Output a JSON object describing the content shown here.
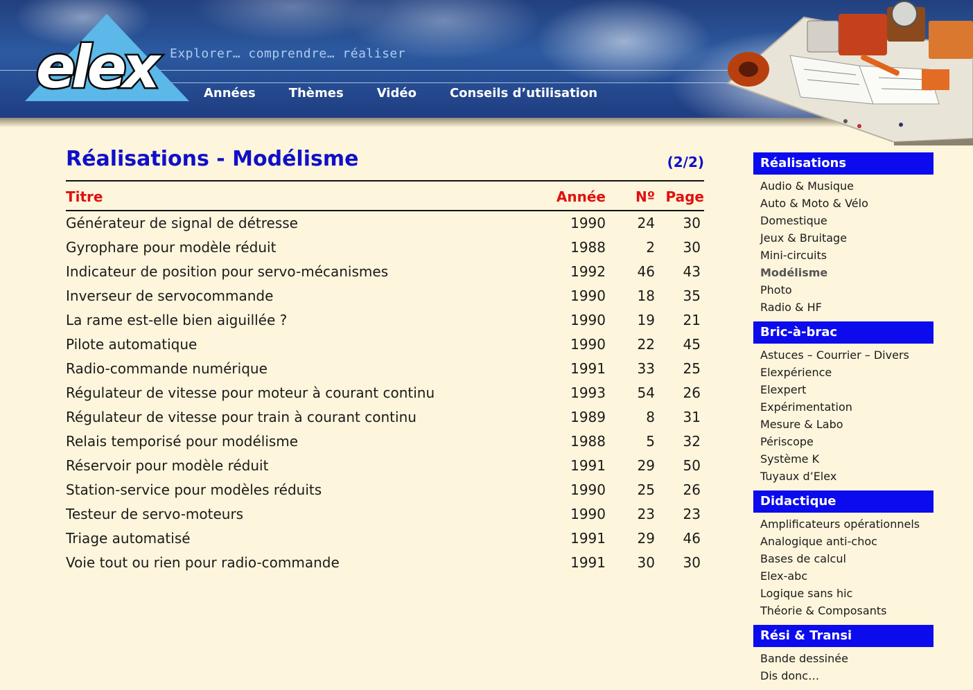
{
  "header": {
    "logo_text": "elex",
    "tagline": "Explorer… comprendre… réaliser",
    "nav": [
      "Années",
      "Thèmes",
      "Vidéo",
      "Conseils d’utilisation"
    ]
  },
  "main": {
    "title": "Réalisations - Modélisme",
    "page_indicator": "(2/2)",
    "columns": {
      "title": "Titre",
      "year": "Année",
      "number": "Nº",
      "page": "Page"
    },
    "rows": [
      {
        "title": "Générateur de signal de détresse",
        "year": "1990",
        "number": "24",
        "page": "30"
      },
      {
        "title": "Gyrophare pour modèle réduit",
        "year": "1988",
        "number": "2",
        "page": "30"
      },
      {
        "title": "Indicateur de position pour servo-mécanismes",
        "year": "1992",
        "number": "46",
        "page": "43"
      },
      {
        "title": "Inverseur de servocommande",
        "year": "1990",
        "number": "18",
        "page": "35"
      },
      {
        "title": "La rame est-elle bien aiguillée ?",
        "year": "1990",
        "number": "19",
        "page": "21"
      },
      {
        "title": "Pilote automatique",
        "year": "1990",
        "number": "22",
        "page": "45"
      },
      {
        "title": "Radio-commande numérique",
        "year": "1991",
        "number": "33",
        "page": "25"
      },
      {
        "title": "Régulateur de vitesse pour moteur à courant continu",
        "year": "1993",
        "number": "54",
        "page": "26"
      },
      {
        "title": "Régulateur de vitesse pour train à courant continu",
        "year": "1989",
        "number": "8",
        "page": "31"
      },
      {
        "title": "Relais temporisé pour modélisme",
        "year": "1988",
        "number": "5",
        "page": "32"
      },
      {
        "title": "Réservoir pour modèle réduit",
        "year": "1991",
        "number": "29",
        "page": "50"
      },
      {
        "title": "Station-service pour modèles réduits",
        "year": "1990",
        "number": "25",
        "page": "26"
      },
      {
        "title": "Testeur de servo-moteurs",
        "year": "1990",
        "number": "23",
        "page": "23"
      },
      {
        "title": "Triage automatisé",
        "year": "1991",
        "number": "29",
        "page": "46"
      },
      {
        "title": "Voie tout ou rien pour radio-commande",
        "year": "1991",
        "number": "30",
        "page": "30"
      }
    ]
  },
  "sidebar": {
    "active_item": "Modélisme",
    "sections": [
      {
        "title": "Réalisations",
        "items": [
          "Audio & Musique",
          "Auto & Moto & Vélo",
          "Domestique",
          "Jeux & Bruitage",
          "Mini-circuits",
          "Modélisme",
          "Photo",
          "Radio & HF"
        ]
      },
      {
        "title": "Bric-à-brac",
        "items": [
          "Astuces – Courrier – Divers",
          "Elexpérience",
          "Elexpert",
          "Expérimentation",
          "Mesure & Labo",
          "Périscope",
          "Système K",
          "Tuyaux d’Elex"
        ]
      },
      {
        "title": "Didactique",
        "items": [
          "Amplificateurs opérationnels",
          "Analogique anti-choc",
          "Bases de calcul",
          "Elex-abc",
          "Logique sans hic",
          "Théorie & Composants"
        ]
      },
      {
        "title": "Rési & Transi",
        "items": [
          "Bande dessinée",
          "Dis donc…"
        ]
      }
    ]
  },
  "colors": {
    "title_blue": "#1010c8",
    "header_red": "#e01010",
    "sidebar_blue": "#0b0bee",
    "background": "#fdf5dc"
  }
}
